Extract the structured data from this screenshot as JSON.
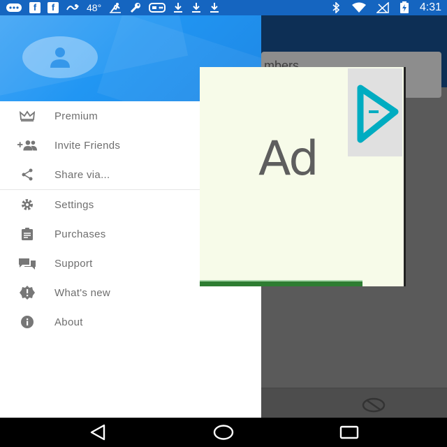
{
  "status_bar": {
    "temperature": "48°",
    "time": "4:31",
    "fb_letter": "f",
    "left_icons": [
      "message-icon",
      "facebook-icon",
      "facebook-icon",
      "weather-icon",
      "run-icon",
      "wrench-icon",
      "game-icon",
      "download-icon",
      "download-icon",
      "download-icon"
    ],
    "right_icons": [
      "bluetooth-icon",
      "wifi-icon",
      "signal-icon",
      "battery-icon"
    ],
    "color": "#1565c0"
  },
  "drawer": {
    "header_color": "#2196f3",
    "items": [
      {
        "label": "Premium",
        "icon": "crown-icon"
      },
      {
        "label": "Invite Friends",
        "icon": "add-people-icon"
      },
      {
        "label": "Share via...",
        "icon": "share-icon"
      },
      {
        "label": "Settings",
        "icon": "gear-icon"
      },
      {
        "label": "Purchases",
        "icon": "clipboard-icon"
      },
      {
        "label": "Support",
        "icon": "chat-icon"
      },
      {
        "label": "What's new",
        "icon": "new-badge-icon"
      },
      {
        "label": "About",
        "icon": "info-icon"
      }
    ]
  },
  "background_app": {
    "search_text": "mbers",
    "toolbar_color": "#0d2f55"
  },
  "ad": {
    "text": "Ad",
    "background": "#f7fbe9",
    "badge_icon": "play-icon",
    "accent": "#2e7d32"
  },
  "nav_bar": {
    "buttons": [
      "back-icon",
      "home-icon",
      "recents-icon"
    ]
  }
}
